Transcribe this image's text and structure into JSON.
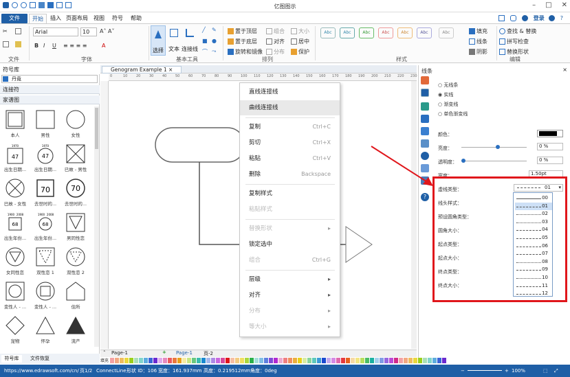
{
  "app": {
    "title": "亿图图示",
    "login": "登录"
  },
  "tabs": [
    "文件",
    "开始",
    "插入",
    "页面布局",
    "视图",
    "符号",
    "帮助"
  ],
  "ribbon": {
    "font_name": "Arial",
    "font_size": "10",
    "groups": [
      "文件",
      "字体",
      "基本工具",
      "排列",
      "样式",
      "编辑"
    ],
    "tools": {
      "select": "选择",
      "text": "文本",
      "connector": "连接线"
    },
    "arrange": [
      "置于顶层",
      "置于底层",
      "旋转和镜像",
      "组合",
      "对齐",
      "分布",
      "大小",
      "居中",
      "保护"
    ],
    "edit_right": [
      "填充",
      "线条",
      "阴影"
    ],
    "edit": [
      "查找 & 替换",
      "拼写检查",
      "替换形状"
    ],
    "style_box": "Abc"
  },
  "left_panel": {
    "title": "符号库",
    "search_value": "丹竟",
    "sections": [
      "连接符",
      "家谱图"
    ],
    "shapes": [
      "本人",
      "男性",
      "女性",
      "出生日期...",
      "出生日期...",
      "已故 - 男性",
      "已故 - 女性",
      "去世时的...",
      "去世时的...",
      "出生年份...",
      "出生年份...",
      "男同性恋",
      "女同性恋",
      "双性恋 1",
      "双性恋 2",
      "变性人 - ...",
      "变性人 - ...",
      "住所",
      "宠物",
      "怀孕",
      "流产"
    ],
    "shape_numbers": {
      "n47a": "47",
      "n47b": "47",
      "n70a": "70",
      "n70b": "70",
      "n68a": "68",
      "n68b": "68",
      "y1970": "1970",
      "y2008": "2008",
      "y1900": "1900"
    },
    "bottom_tabs": [
      "符号库",
      "文件恢复"
    ]
  },
  "document": {
    "tab": "Genogram Example 1",
    "ruler_nums": [
      "0",
      "10",
      "20",
      "30",
      "40",
      "50",
      "60",
      "70",
      "80",
      "90",
      "100",
      "110",
      "120",
      "130",
      "140",
      "150",
      "160",
      "170",
      "180",
      "190",
      "200",
      "210",
      "220",
      "230"
    ]
  },
  "context_menu": {
    "items": [
      {
        "label": "直线连接线",
        "shortcut": ""
      },
      {
        "label": "曲线连接线",
        "shortcut": ""
      },
      {
        "label": "复制",
        "shortcut": "Ctrl+C"
      },
      {
        "label": "剪切",
        "shortcut": "Ctrl+X"
      },
      {
        "label": "粘贴",
        "shortcut": "Ctrl+V"
      },
      {
        "label": "删除",
        "shortcut": "Backspace"
      },
      {
        "label": "复制样式",
        "shortcut": ""
      },
      {
        "label": "粘贴样式",
        "shortcut": ""
      },
      {
        "label": "替换形状",
        "shortcut": ""
      },
      {
        "label": "锁定选中",
        "shortcut": ""
      },
      {
        "label": "组合",
        "shortcut": "Ctrl+G"
      },
      {
        "label": "层级",
        "shortcut": ""
      },
      {
        "label": "对齐",
        "shortcut": ""
      },
      {
        "label": "分布",
        "shortcut": ""
      },
      {
        "label": "等大小",
        "shortcut": ""
      }
    ]
  },
  "right_panel": {
    "title": "线条",
    "options": [
      "无线条",
      "实线",
      "渐变线",
      "单色渐变线"
    ],
    "fields": {
      "color": "颜色：",
      "brightness": "亮度：",
      "transparency": "透明度：",
      "width": "宽度：",
      "dash": "虚线类型：",
      "arrow_style": "线头样式：",
      "preset_corner": "预设圆角类型：",
      "corner_size": "圆角大小：",
      "begin_type": "起点类型：",
      "begin_size": "起点大小：",
      "end_type": "终点类型：",
      "end_size": "终点大小："
    },
    "values": {
      "brightness": "0 %",
      "transparency": "0 %",
      "width": "1.50pt",
      "dash": "01"
    },
    "dash_list": [
      "00",
      "01",
      "02",
      "03",
      "04",
      "05",
      "06",
      "07",
      "08",
      "09",
      "10",
      "11",
      "12"
    ]
  },
  "pages": {
    "page1": "Page-1",
    "add": "+",
    "page_tab": "Page-1",
    "page2": "页-2",
    "fill_label": "填充"
  },
  "status": {
    "url": "https://www.edrawsoft.com/cn/",
    "page": "页1/2",
    "shape": "ConnectLine",
    "id": "形状 ID：106",
    "width": "宽度：161.937mm",
    "height": "高度：0.219512mm",
    "angle": "角度：0deg",
    "zoom": "100%"
  }
}
